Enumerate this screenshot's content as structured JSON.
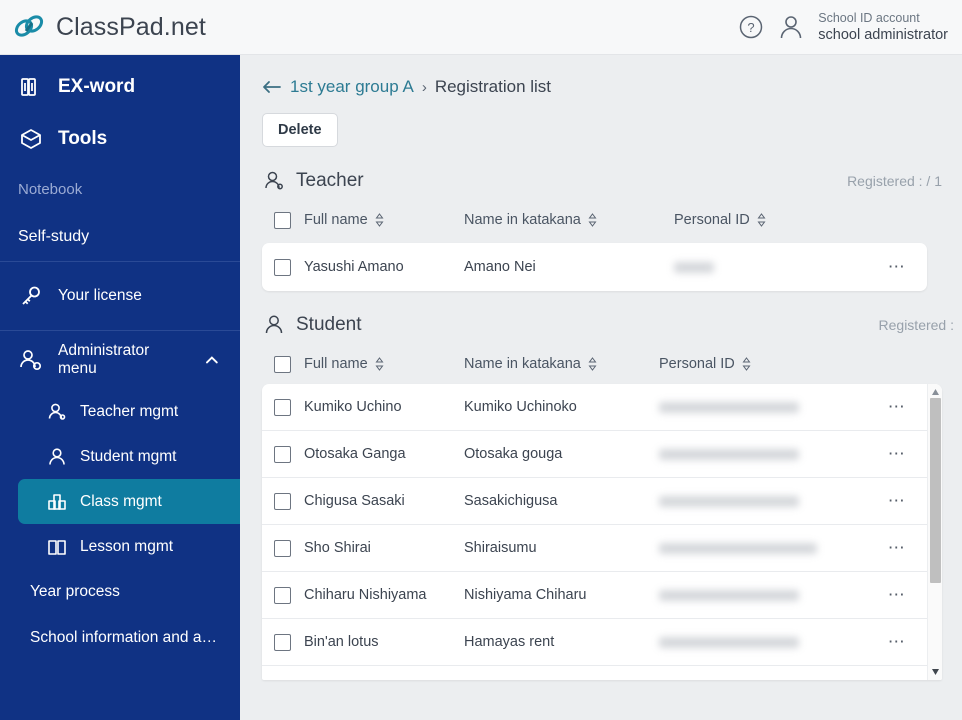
{
  "header": {
    "brand": "ClassPad.net",
    "logo_icon": "link-rings-icon",
    "help_icon": "question-circle-icon",
    "user_icon": "user-avatar-icon",
    "account_label": "School ID account",
    "account_name": "school administrator"
  },
  "sidebar": {
    "items": [
      {
        "label": "EX-word",
        "icon": "books-icon",
        "type": "top"
      },
      {
        "label": "Tools",
        "icon": "toolbox-icon",
        "type": "top"
      },
      {
        "label": "Notebook",
        "icon": "",
        "type": "dim"
      },
      {
        "label": "Self-study",
        "icon": "",
        "type": "plain"
      },
      {
        "label": "Your license",
        "icon": "key-icon",
        "type": "plain"
      },
      {
        "label": "Administrator menu",
        "icon": "admin-users-icon",
        "type": "section",
        "chevron": "chevron-up-icon"
      }
    ],
    "admin_items": [
      {
        "label": "Teacher mgmt",
        "icon": "teacher-icon",
        "active": false
      },
      {
        "label": "Student mgmt",
        "icon": "student-icon",
        "active": false
      },
      {
        "label": "Class mgmt",
        "icon": "class-icon",
        "active": true
      },
      {
        "label": "Lesson mgmt",
        "icon": "book-open-icon",
        "active": false
      }
    ],
    "footer_items": [
      {
        "label": "Year process"
      },
      {
        "label": "School information and a…"
      }
    ],
    "active_color": "#0f7ca0",
    "background_color": "#103284"
  },
  "breadcrumb": {
    "back_icon": "arrow-left-icon",
    "parent": "1st year group A",
    "separator": "›",
    "current": "Registration list"
  },
  "toolbar": {
    "delete_label": "Delete"
  },
  "columns": {
    "full_name": "Full name",
    "katakana": "Name in katakana",
    "personal_id": "Personal ID",
    "sort_icon": "sort-updown-icon",
    "more_icon": "ellipsis-icon",
    "checkbox_icon": "checkbox-unchecked-icon"
  },
  "teacher_section": {
    "icon": "teacher-icon",
    "title": "Teacher",
    "registered": "Registered : / 1",
    "rows": [
      {
        "full_name": "Yasushi Amano",
        "katakana": "Amano Nei",
        "personal_id_redacted": true,
        "redact_width": 40
      }
    ]
  },
  "student_section": {
    "icon": "student-icon",
    "title": "Student",
    "registered": "Registered :",
    "rows": [
      {
        "full_name": "Kumiko Uchino",
        "katakana": "Kumiko Uchinoko",
        "personal_id_redacted": true,
        "redact_width": 140
      },
      {
        "full_name": "Otosaka Ganga",
        "katakana": "Otosaka gouga",
        "personal_id_redacted": true,
        "redact_width": 140
      },
      {
        "full_name": "Chigusa Sasaki",
        "katakana": "Sasakichigusa",
        "personal_id_redacted": true,
        "redact_width": 140
      },
      {
        "full_name": "Sho Shirai",
        "katakana": "Shiraisumu",
        "personal_id_redacted": true,
        "redact_width": 158
      },
      {
        "full_name": "Chiharu Nishiyama",
        "katakana": "Nishiyama Chiharu",
        "personal_id_redacted": true,
        "redact_width": 140
      },
      {
        "full_name": "Bin'an lotus",
        "katakana": "Hamayas rent",
        "personal_id_redacted": true,
        "redact_width": 140
      }
    ],
    "scrollbar": {
      "up_icon": "caret-up-icon",
      "down_icon": "caret-down-icon"
    }
  }
}
